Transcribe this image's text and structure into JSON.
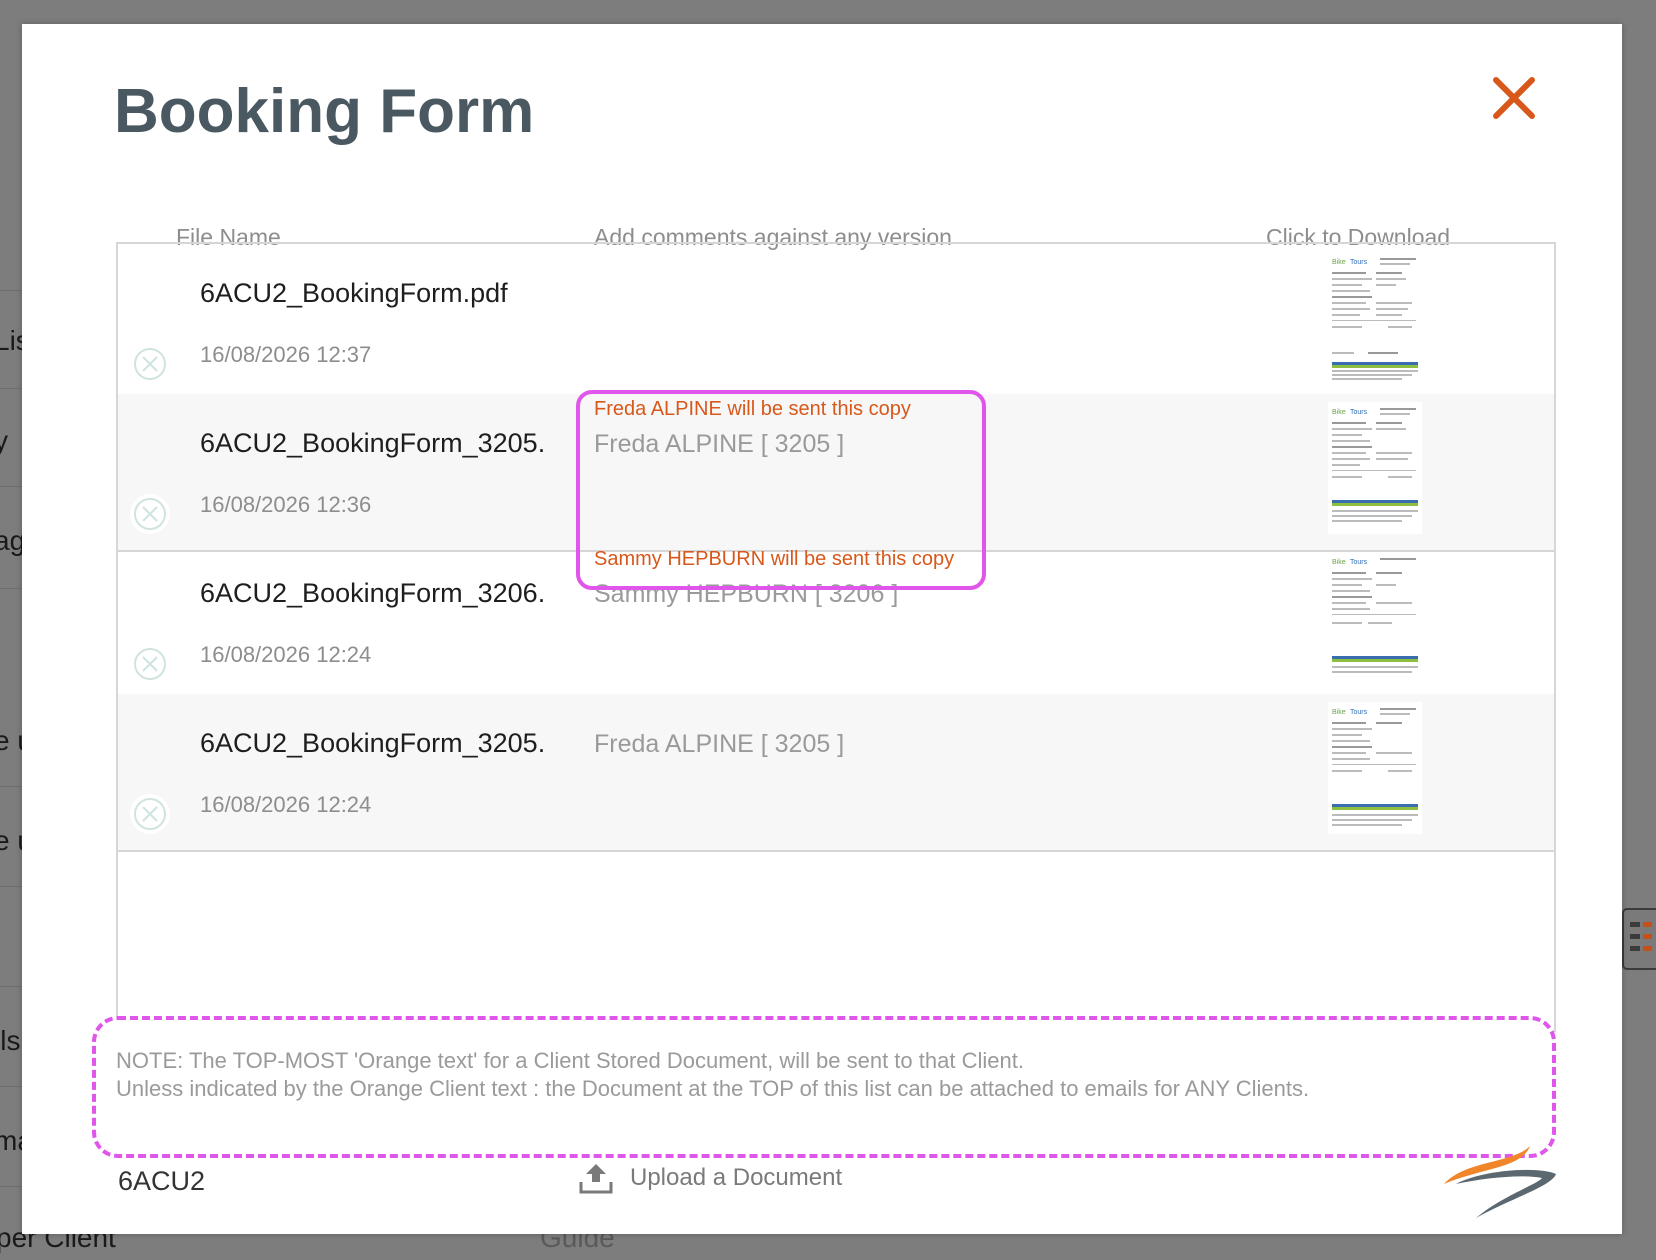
{
  "background": {
    "left_fragments": [
      "Lis",
      "y",
      "ag",
      "e u",
      "e u",
      "ils",
      "ma"
    ],
    "bottom_labels": [
      "per Client",
      "Guide"
    ]
  },
  "modal": {
    "title": "Booking Form",
    "close_icon": "close-x-icon",
    "accent_color": "#d8581b",
    "highlight_color": "#e055ea",
    "columns": {
      "file_name": "File Name",
      "comments": "Add comments against any version",
      "download": "Click to Download"
    },
    "files": [
      {
        "name": "6ACU2_BookingForm.pdf",
        "date": "16/08/2026 12:37",
        "send_note": "",
        "client": ""
      },
      {
        "name": "6ACU2_BookingForm_3205.",
        "date": "16/08/2026 12:36",
        "send_note": "Freda ALPINE will be sent this copy",
        "client": "Freda ALPINE [ 3205 ]"
      },
      {
        "name": "6ACU2_BookingForm_3206.",
        "date": "16/08/2026 12:24",
        "send_note": "Sammy HEPBURN will be sent this copy",
        "client": "Sammy HEPBURN [ 3206 ]"
      },
      {
        "name": "6ACU2_BookingForm_3205.",
        "date": "16/08/2026 12:24",
        "send_note": "",
        "client": "Freda ALPINE [ 3205 ]"
      }
    ],
    "note_lines": [
      "NOTE: The TOP-MOST 'Orange text' for a Client Stored Document, will be sent to that Client.",
      "Unless indicated by the Orange Client text : the Document at the TOP of this list can be attached to emails for ANY Clients."
    ],
    "reference_code": "6ACU2",
    "upload_label": "Upload a Document",
    "upload_icon": "upload-icon",
    "logo_icon": "swoosh-logo-icon"
  }
}
